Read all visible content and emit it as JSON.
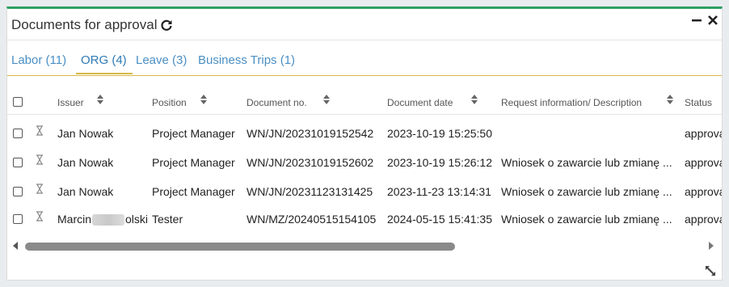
{
  "widget": {
    "title": "Documents for approval",
    "refresh_icon": "refresh-icon",
    "minimize_icon": "minimize-icon",
    "close_icon": "close-icon",
    "accent_color": "#2e9e63",
    "tab_accent_color": "#d7b84a"
  },
  "tabs": [
    {
      "label": "Labor (11)",
      "active": false
    },
    {
      "label": "ORG (4)",
      "active": true
    },
    {
      "label": "Leave (3)",
      "active": false
    },
    {
      "label": "Business Trips (1)",
      "active": false
    }
  ],
  "table": {
    "columns": [
      {
        "label": "Issuer",
        "sortable": true
      },
      {
        "label": "Position",
        "sortable": true
      },
      {
        "label": "Document no.",
        "sortable": true
      },
      {
        "label": "Document date",
        "sortable": true
      },
      {
        "label": "Request information/ Description",
        "sortable": true
      },
      {
        "label": "Status",
        "sortable": false
      }
    ],
    "rows": [
      {
        "issuer": "Jan Nowak",
        "position": "Project Manager",
        "document_no": "WN/JN/20231019152542",
        "document_date": "2023-10-19 15:25:50",
        "description": "",
        "status": "approva"
      },
      {
        "issuer": "Jan Nowak",
        "position": "Project Manager",
        "document_no": "WN/JN/20231019152602",
        "document_date": "2023-10-19 15:26:12",
        "description": "Wniosek o zawarcie lub zmianę ...",
        "status": "approva"
      },
      {
        "issuer": "Jan Nowak",
        "position": "Project Manager",
        "document_no": "WN/JN/20231123131425",
        "document_date": "2023-11-23 13:14:31",
        "description": "Wniosek o zawarcie lub zmianę ...",
        "status": "approva"
      },
      {
        "issuer_prefix": "Marcin",
        "issuer_suffix": "olski",
        "position": "Tester",
        "document_no": "WN/MZ/20240515154105",
        "document_date": "2024-05-15 15:41:35",
        "description": "Wniosek o zawarcie lub zmianę ...",
        "status": "approva"
      }
    ],
    "row_icon": "hourglass-icon",
    "sort_icon": "sort-icon"
  },
  "scrollbar": {
    "left_arrow_icon": "arrow-left-icon",
    "right_arrow_icon": "arrow-right-icon",
    "position": 0
  },
  "resize_icon": "expand-icon"
}
